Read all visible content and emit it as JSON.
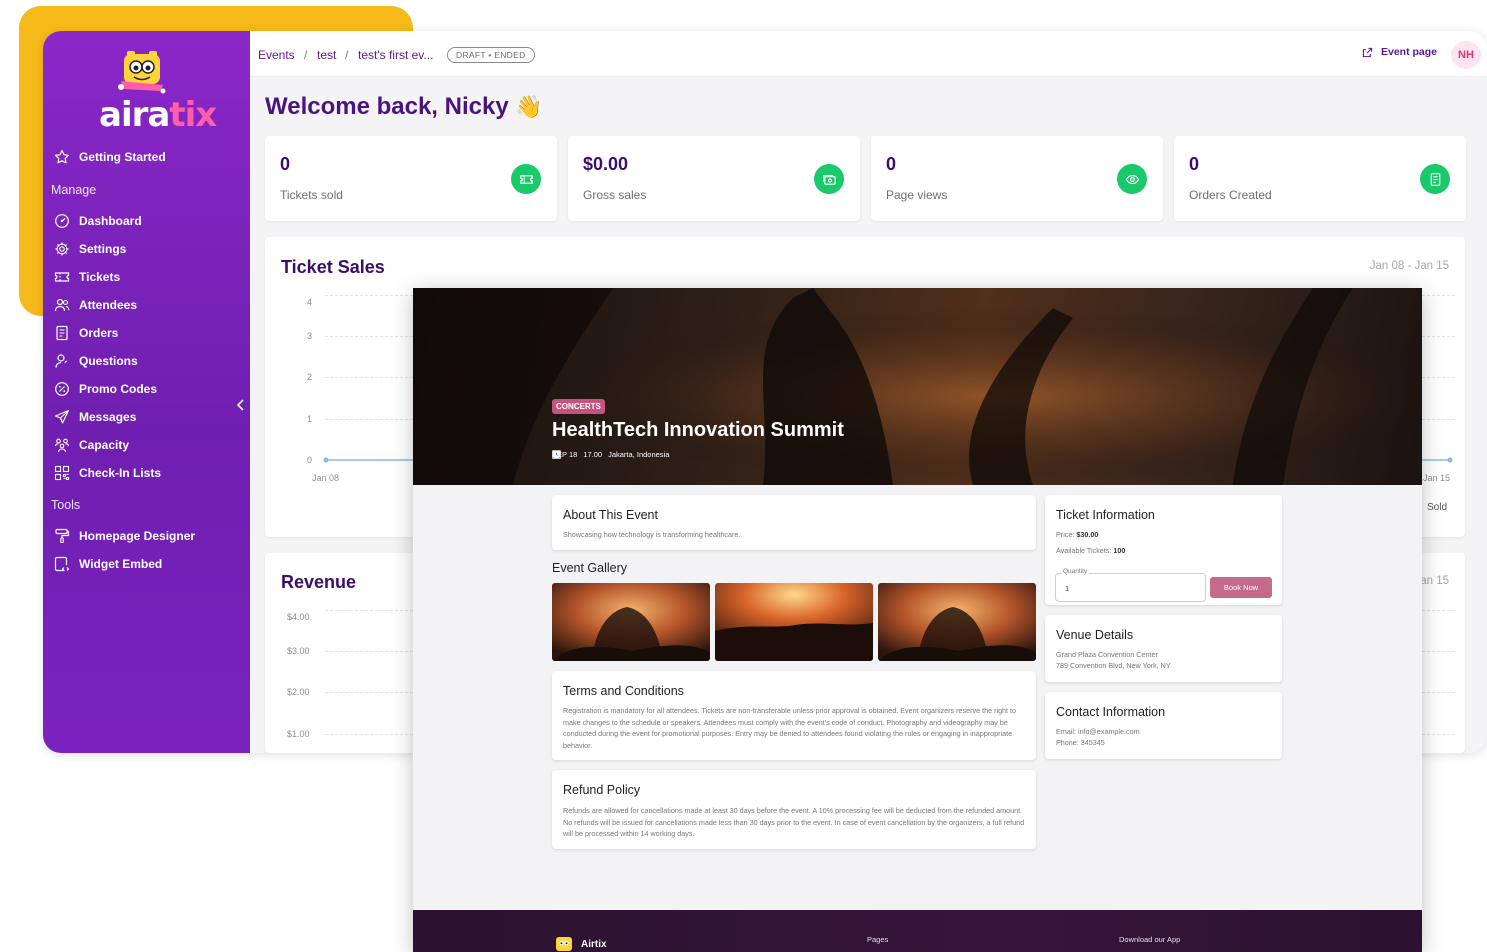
{
  "colors": {
    "sidebar": "#7a22bf",
    "accent_purple": "#5a189a",
    "stat_icon_green": "#19c96a",
    "yellow_card": "#f6b91a",
    "hero_badge": "#c4547d",
    "book_button": "#c46a8a",
    "avatar_bg": "#fde4ef"
  },
  "logo": {
    "text_main": "aira",
    "text_accent": "tix"
  },
  "sidebar": {
    "getting_started": "Getting Started",
    "manage_label": "Manage",
    "manage_items": [
      {
        "label": "Dashboard",
        "icon": "dashboard-gauge-icon"
      },
      {
        "label": "Settings",
        "icon": "gear-icon"
      },
      {
        "label": "Tickets",
        "icon": "ticket-icon"
      },
      {
        "label": "Attendees",
        "icon": "users-icon"
      },
      {
        "label": "Orders",
        "icon": "receipt-icon"
      },
      {
        "label": "Questions",
        "icon": "user-question-icon"
      },
      {
        "label": "Promo Codes",
        "icon": "percent-badge-icon"
      },
      {
        "label": "Messages",
        "icon": "send-icon"
      },
      {
        "label": "Capacity",
        "icon": "group-icon"
      },
      {
        "label": "Check-In Lists",
        "icon": "qr-code-icon"
      }
    ],
    "tools_label": "Tools",
    "tools_items": [
      {
        "label": "Homepage Designer",
        "icon": "paint-roller-icon"
      },
      {
        "label": "Widget Embed",
        "icon": "embed-icon"
      }
    ]
  },
  "breadcrumb": {
    "items": [
      "Events",
      "test",
      "test's first ev..."
    ],
    "separator": "/",
    "status": "DRAFT • ENDED"
  },
  "header": {
    "event_page_label": "Event page",
    "avatar_initials": "NH"
  },
  "welcome": {
    "text": "Welcome back, Nicky",
    "emoji": "👋"
  },
  "stats": [
    {
      "value": "0",
      "label": "Tickets sold",
      "icon": "ticket-icon"
    },
    {
      "value": "$0.00",
      "label": "Gross sales",
      "icon": "cash-icon"
    },
    {
      "value": "0",
      "label": "Page views",
      "icon": "eye-icon"
    },
    {
      "value": "0",
      "label": "Orders Created",
      "icon": "receipt-icon"
    }
  ],
  "ticket_sales": {
    "title": "Ticket Sales",
    "range": "Jan 08 - Jan 15",
    "y_ticks": [
      "4",
      "3",
      "2",
      "1",
      "0"
    ],
    "x_start": "Jan 08",
    "x_end": "Jan 15",
    "legend": "Sold"
  },
  "revenue": {
    "title": "Revenue",
    "range": "Jan 15",
    "y_ticks": [
      "$4.00",
      "$3.00",
      "$2.00",
      "$1.00"
    ]
  },
  "chart_data": [
    {
      "type": "line",
      "title": "Ticket Sales",
      "x": [
        "Jan 08",
        "Jan 15"
      ],
      "series": [
        {
          "name": "Sold",
          "values": [
            0,
            0
          ]
        }
      ],
      "ylim": [
        0,
        4
      ]
    },
    {
      "type": "line",
      "title": "Revenue",
      "ylim": [
        0,
        4
      ]
    }
  ],
  "event_page": {
    "category": "CONCERTS",
    "title": "HealthTech Innovation Summit",
    "date": "SEP 18",
    "time": "17.00",
    "location": "Jakarta, Indonesia",
    "about": {
      "title": "About This Event",
      "body": "Showcasing how technology is transforming healthcare."
    },
    "gallery_title": "Event Gallery",
    "terms": {
      "title": "Terms and Conditions",
      "body": "Registration is mandatory for all attendees. Tickets are non-transferable unless prior approval is obtained. Event organizers reserve the right to make changes to the schedule or speakers. Attendees must comply with the event's code of conduct. Photography and videography may be conducted during the event for promotional purposes. Entry may be denied to attendees found violating the rules or engaging in inappropriate behavior."
    },
    "refund": {
      "title": "Refund Policy",
      "body": "Refunds are allowed for cancellations made at least 30 days before the event. A 10% processing fee will be deducted from the refunded amount. No refunds will be issued for cancellations made less than 30 days prior to the event. In case of event cancellation by the organizers, a full refund will be processed within 14 working days."
    },
    "ticket_info": {
      "title": "Ticket Information",
      "price_label": "Price:",
      "price": "$30.00",
      "available_label": "Available Tickets:",
      "available": "100",
      "quantity_label": "Quantity",
      "quantity_value": "1",
      "book_label": "Book Now"
    },
    "venue": {
      "title": "Venue Details",
      "name": "Grand Plaza Convention Center",
      "address": "789 Convention Blvd, New York, NY"
    },
    "contact": {
      "title": "Contact Information",
      "email": "Email: info@example.com",
      "phone": "Phone: 345345"
    },
    "footer": {
      "brand": "Airtix",
      "pages_label": "Pages",
      "download_label": "Download our App"
    }
  }
}
